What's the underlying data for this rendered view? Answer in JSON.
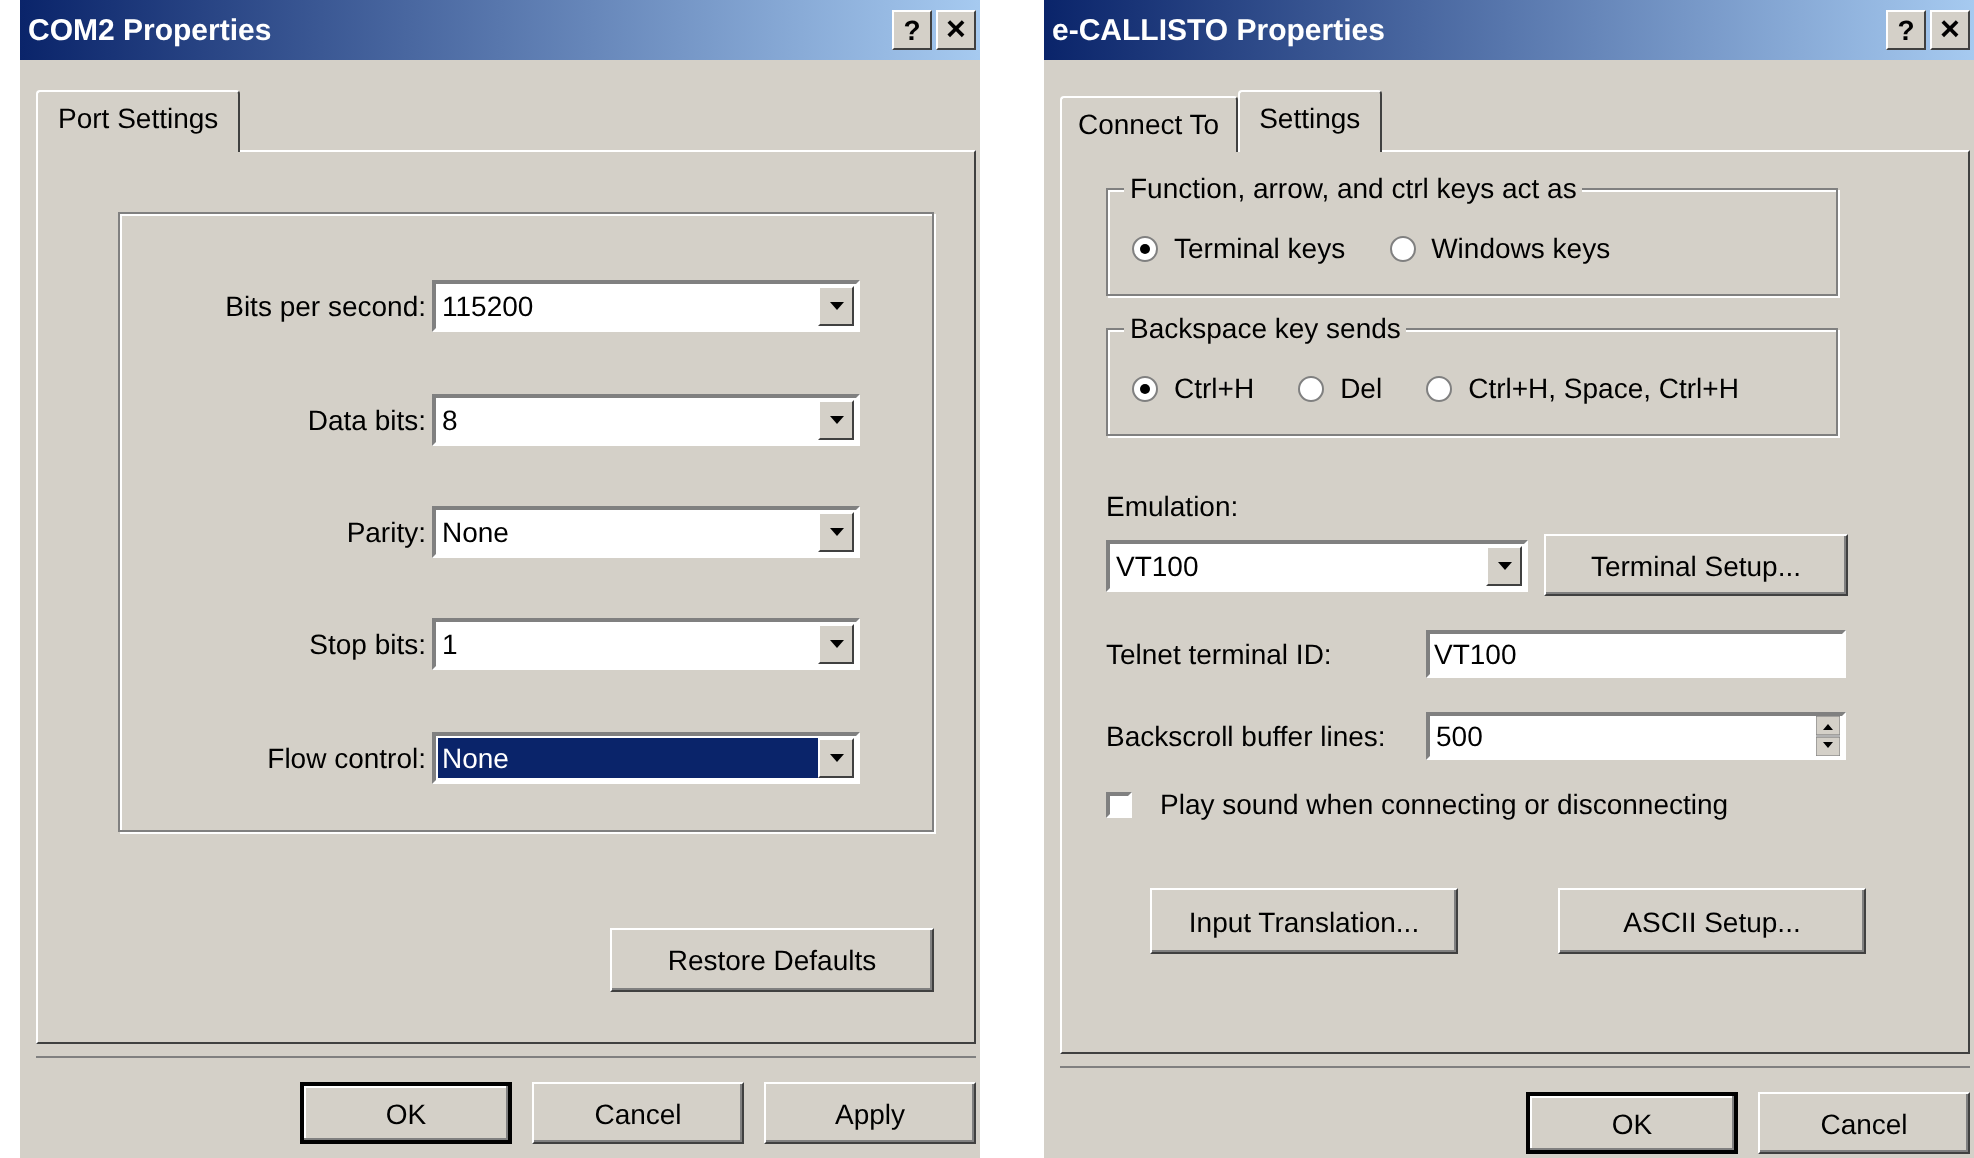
{
  "com2_dialog": {
    "title": "COM2 Properties",
    "title_buttons": [
      {
        "kind": "help",
        "label": "?"
      },
      {
        "kind": "close",
        "label": "×"
      }
    ],
    "tabs": [
      {
        "label": "Port Settings",
        "selected": true
      }
    ],
    "fields": [
      {
        "label": "Bits per second:",
        "value": "115200",
        "focused": false
      },
      {
        "label": "Data bits:",
        "value": "8",
        "focused": false
      },
      {
        "label": "Parity:",
        "value": "None",
        "focused": false
      },
      {
        "label": "Stop bits:",
        "value": "1",
        "focused": false
      },
      {
        "label": "Flow control:",
        "value": "None",
        "focused": true
      }
    ],
    "restore_button": "Restore Defaults",
    "footer_buttons": [
      {
        "label": "OK",
        "default": true
      },
      {
        "label": "Cancel",
        "default": false
      },
      {
        "label": "Apply",
        "default": false
      }
    ]
  },
  "callisto_dialog": {
    "title": "e-CALLISTO Properties",
    "title_buttons": [
      {
        "kind": "help",
        "label": "?"
      },
      {
        "kind": "close",
        "label": "×"
      }
    ],
    "tabs": [
      {
        "label": "Connect To",
        "selected": false
      },
      {
        "label": "Settings",
        "selected": true
      }
    ],
    "groups": [
      {
        "legend": "Function, arrow, and ctrl keys act as",
        "options": [
          {
            "label": "Terminal keys",
            "selected": true
          },
          {
            "label": "Windows keys",
            "selected": false
          }
        ]
      },
      {
        "legend": "Backspace key sends",
        "options": [
          {
            "label": "Ctrl+H",
            "selected": true
          },
          {
            "label": "Del",
            "selected": false
          },
          {
            "label": "Ctrl+H, Space, Ctrl+H",
            "selected": false
          }
        ]
      }
    ],
    "emulation": {
      "label": "Emulation:",
      "value": "VT100",
      "button": "Terminal Setup..."
    },
    "telnet_id": {
      "label": "Telnet terminal ID:",
      "value": "VT100"
    },
    "backscroll": {
      "label": "Backscroll buffer lines:",
      "value": "500"
    },
    "play_sound": {
      "label": "Play sound when connecting or disconnecting",
      "checked": false
    },
    "action_buttons": [
      "Input Translation...",
      "ASCII Setup..."
    ],
    "footer_buttons": [
      {
        "label": "OK",
        "default": true
      },
      {
        "label": "Cancel",
        "default": false
      }
    ]
  }
}
